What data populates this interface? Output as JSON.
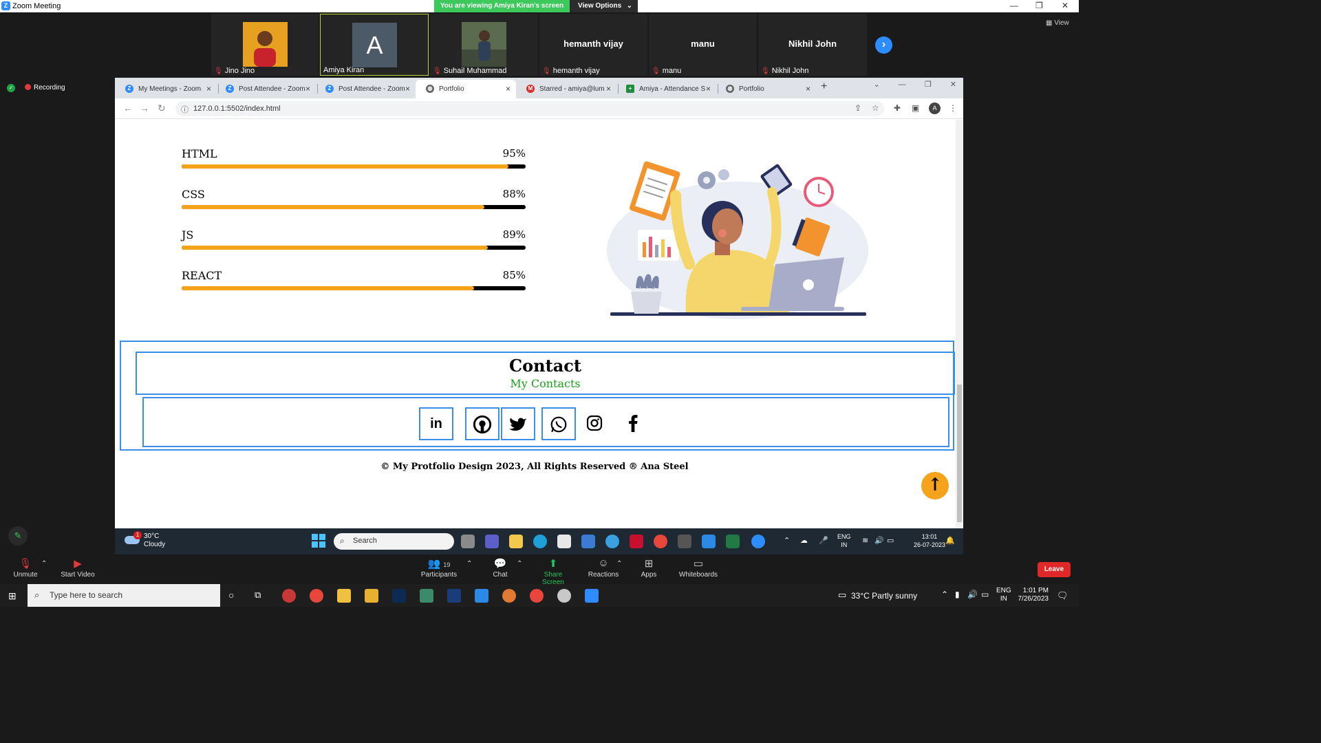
{
  "zoom": {
    "window_title": "Zoom Meeting",
    "share_banner": "You are viewing Amiya Kiran's screen",
    "view_options": "View Options",
    "view_label": "View",
    "recording": "Recording",
    "participants": [
      {
        "name": "Jino Jino",
        "display": "photo"
      },
      {
        "name": "Amiya Kiran",
        "display": "A"
      },
      {
        "name": "Suhail Muhammad",
        "display": "photo"
      },
      {
        "name": "hemanth vijay",
        "display": "hemanth vijay"
      },
      {
        "name": "manu",
        "display": "manu"
      },
      {
        "name": "Nikhil John",
        "display": "Nikhil John"
      }
    ],
    "controls": {
      "unmute": "Unmute",
      "start_video": "Start Video",
      "participants": "Participants",
      "participant_count": "19",
      "chat": "Chat",
      "share_screen": "Share Screen",
      "reactions": "Reactions",
      "apps": "Apps",
      "whiteboards": "Whiteboards",
      "leave": "Leave"
    }
  },
  "browser": {
    "tabs": [
      {
        "label": "My Meetings - Zoom",
        "icon": "zoom-icon"
      },
      {
        "label": "Post Attendee - Zoom",
        "icon": "zoom-icon"
      },
      {
        "label": "Post Attendee - Zoom",
        "icon": "zoom-icon"
      },
      {
        "label": "Portfolio",
        "icon": "globe-icon"
      },
      {
        "label": "Starred - amiya@lum",
        "icon": "gmail-icon"
      },
      {
        "label": "Amiya - Attendance S",
        "icon": "sheets-icon"
      },
      {
        "label": "Portfolio",
        "icon": "globe-icon"
      }
    ],
    "url": "127.0.0.1:5502/index.html"
  },
  "page": {
    "skills": [
      {
        "name": "HTML",
        "percent_label": "95%",
        "level": 0.95
      },
      {
        "name": "CSS",
        "percent_label": "88%",
        "level": 0.88
      },
      {
        "name": "JS",
        "percent_label": "89%",
        "level": 0.89
      },
      {
        "name": "REACT",
        "percent_label": "85%",
        "level": 0.85
      }
    ],
    "contact_title": "Contact",
    "contact_subtitle": "My Contacts",
    "social": [
      "linkedin-icon",
      "github-icon",
      "twitter-icon",
      "whatsapp-icon",
      "instagram-icon",
      "facebook-icon"
    ],
    "footer": "© My Protfolio Design 2023, All Rights Reserved ® Ana Steel"
  },
  "shared_taskbar": {
    "temperature": "30°C",
    "condition": "Cloudy",
    "badge": "1",
    "search": "Search",
    "lang_top": "ENG",
    "lang_bottom": "IN",
    "time": "13:01",
    "date": "26-07-2023"
  },
  "win_taskbar": {
    "search": "Type here to search",
    "weather": "33°C  Partly sunny",
    "lang_top": "ENG",
    "lang_bottom": "IN",
    "time": "1:01 PM",
    "date": "7/26/2023"
  },
  "colors": {
    "accent_orange": "#f5a31a",
    "contact_border": "#3b8ee8",
    "subtitle_green": "#17a317",
    "share_green": "#3cc85a",
    "leave_red": "#e02828"
  }
}
